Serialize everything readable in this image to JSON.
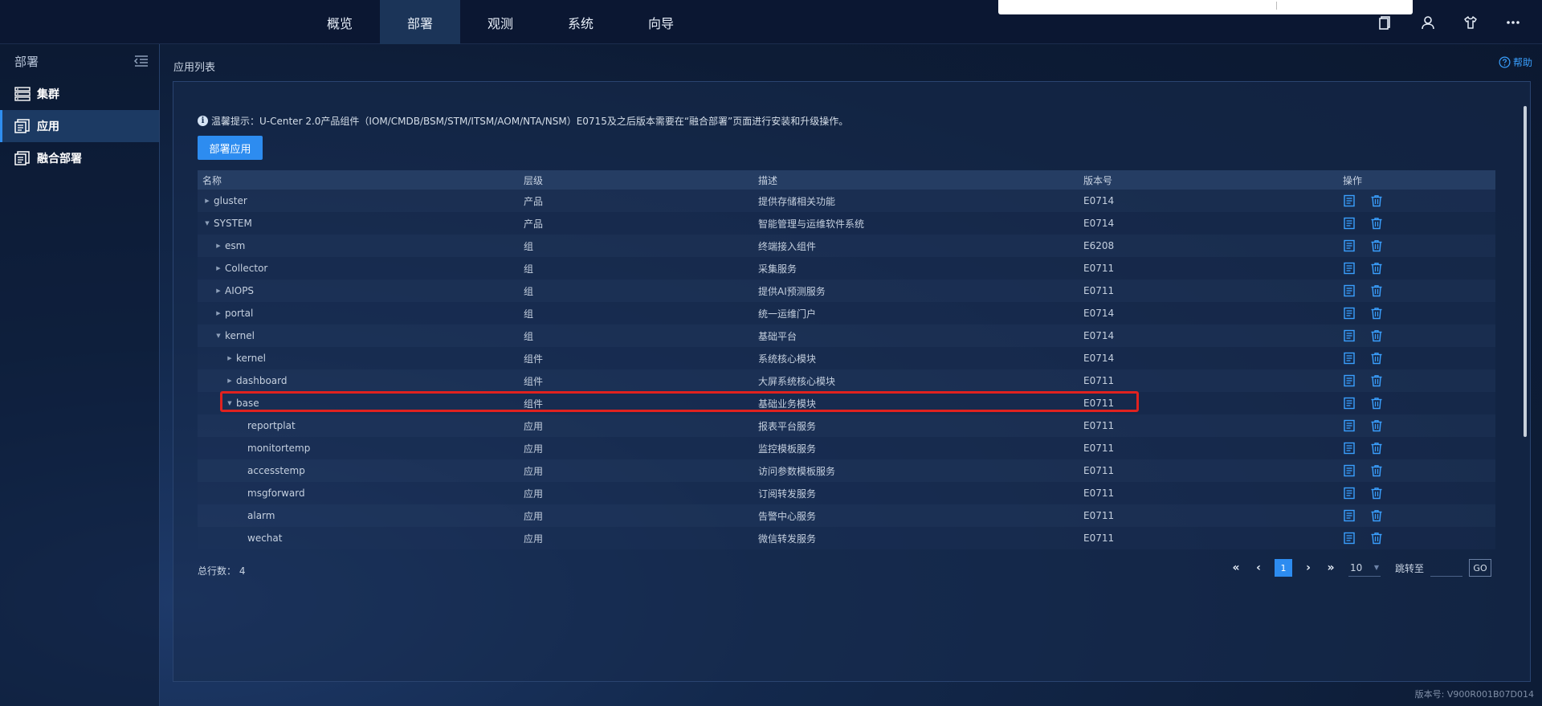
{
  "top_nav": {
    "items": [
      "概览",
      "部署",
      "观测",
      "系统",
      "向导"
    ],
    "active_index": 1
  },
  "top_icons": [
    "document-icon",
    "user-icon",
    "shirt-icon",
    "more-icon"
  ],
  "sidebar": {
    "title": "部署",
    "items": [
      {
        "label": "集群",
        "icon": "server-icon"
      },
      {
        "label": "应用",
        "icon": "app-icon"
      },
      {
        "label": "融合部署",
        "icon": "deploy-icon"
      }
    ],
    "active_index": 1
  },
  "main": {
    "title": "应用列表",
    "help": "帮助",
    "tip": "温馨提示：U-Center 2.0产品组件（IOM/CMDB/BSM/STM/ITSM/AOM/NTA/NSM）E0715及之后版本需要在“融合部署”页面进行安装和升级操作。",
    "deploy_button": "部署应用"
  },
  "table": {
    "columns": [
      "名称",
      "层级",
      "描述",
      "版本号",
      "操作"
    ],
    "rows": [
      {
        "name": "gluster",
        "level": "产品",
        "desc": "提供存储相关功能",
        "version": "E0714",
        "depth": 0,
        "arrow": "collapsed"
      },
      {
        "name": "SYSTEM",
        "level": "产品",
        "desc": "智能管理与运维软件系统",
        "version": "E0714",
        "depth": 0,
        "arrow": "expanded"
      },
      {
        "name": "esm",
        "level": "组",
        "desc": "终端接入组件",
        "version": "E6208",
        "depth": 1,
        "arrow": "collapsed"
      },
      {
        "name": "Collector",
        "level": "组",
        "desc": "采集服务",
        "version": "E0711",
        "depth": 1,
        "arrow": "collapsed"
      },
      {
        "name": "AIOPS",
        "level": "组",
        "desc": "提供AI预测服务",
        "version": "E0711",
        "depth": 1,
        "arrow": "collapsed"
      },
      {
        "name": "portal",
        "level": "组",
        "desc": "统一运维门户",
        "version": "E0714",
        "depth": 1,
        "arrow": "collapsed"
      },
      {
        "name": "kernel",
        "level": "组",
        "desc": "基础平台",
        "version": "E0714",
        "depth": 1,
        "arrow": "expanded"
      },
      {
        "name": "kernel",
        "level": "组件",
        "desc": "系统核心模块",
        "version": "E0714",
        "depth": 2,
        "arrow": "collapsed"
      },
      {
        "name": "dashboard",
        "level": "组件",
        "desc": "大屏系统核心模块",
        "version": "E0711",
        "depth": 2,
        "arrow": "collapsed"
      },
      {
        "name": "base",
        "level": "组件",
        "desc": "基础业务模块",
        "version": "E0711",
        "depth": 2,
        "arrow": "expanded"
      },
      {
        "name": "reportplat",
        "level": "应用",
        "desc": "报表平台服务",
        "version": "E0711",
        "depth": 3,
        "arrow": "none"
      },
      {
        "name": "monitortemp",
        "level": "应用",
        "desc": "监控模板服务",
        "version": "E0711",
        "depth": 3,
        "arrow": "none"
      },
      {
        "name": "accesstemp",
        "level": "应用",
        "desc": "访问参数模板服务",
        "version": "E0711",
        "depth": 3,
        "arrow": "none"
      },
      {
        "name": "msgforward",
        "level": "应用",
        "desc": "订阅转发服务",
        "version": "E0711",
        "depth": 3,
        "arrow": "none"
      },
      {
        "name": "alarm",
        "level": "应用",
        "desc": "告警中心服务",
        "version": "E0711",
        "depth": 3,
        "arrow": "none"
      },
      {
        "name": "wechat",
        "level": "应用",
        "desc": "微信转发服务",
        "version": "E0711",
        "depth": 3,
        "arrow": "none"
      }
    ]
  },
  "footer": {
    "total_label": "总行数：",
    "total_value": "4",
    "current_page": "1",
    "page_size": "10",
    "jump_label": "跳转至",
    "go_label": "GO"
  },
  "version_text": "版本号: V900R001B07D014",
  "colors": {
    "accent": "#2d8cf0",
    "highlight_border": "#e0221f",
    "action_icon": "#3aa0ff"
  }
}
